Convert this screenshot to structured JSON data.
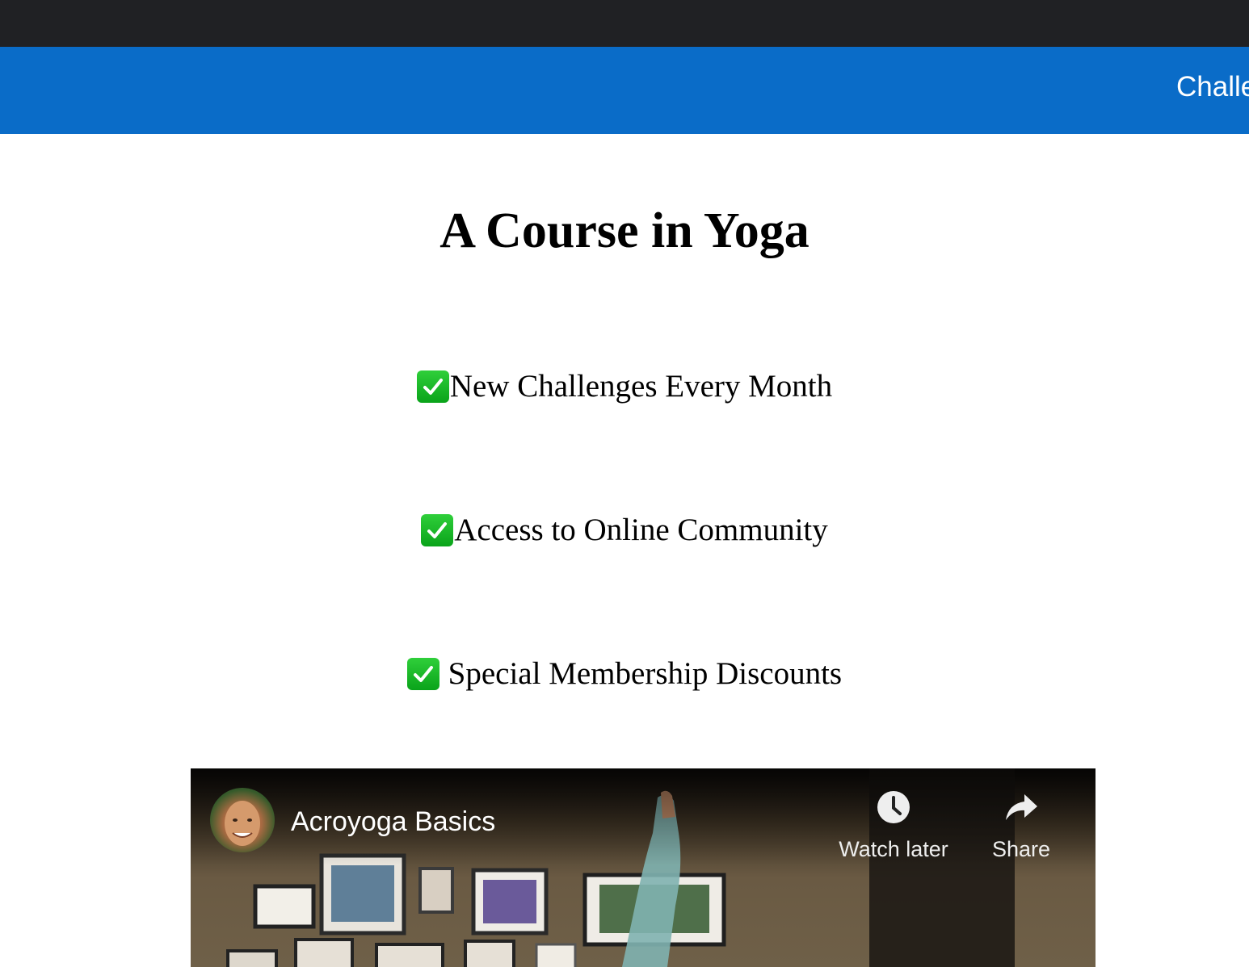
{
  "header": {
    "nav_link": "Challe"
  },
  "main": {
    "title": "A Course in Yoga",
    "features": [
      "New Challenges Every Month",
      "Access to Online Community",
      " Special Membership Discounts"
    ]
  },
  "video": {
    "title": "Acroyoga Basics",
    "watch_later": "Watch later",
    "share": "Share"
  },
  "icons": {
    "feature_check": "check-mark-button-icon",
    "watch_later": "clock-icon",
    "share": "share-arrow-icon"
  },
  "colors": {
    "topbar": "#202124",
    "navbar": "#0a6cc8",
    "check": "#18b528"
  }
}
